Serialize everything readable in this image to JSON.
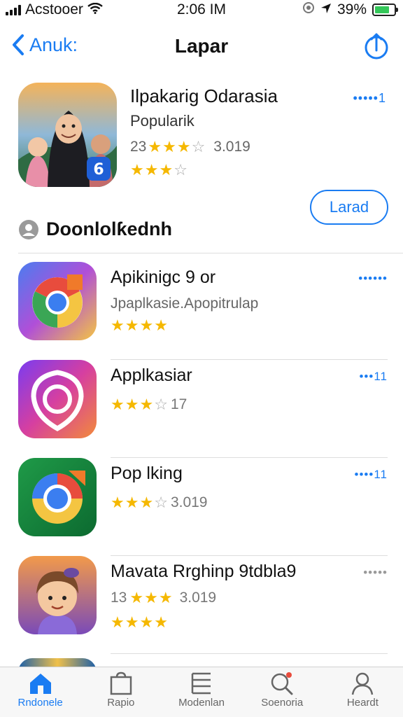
{
  "status": {
    "carrier": "Acstooer",
    "time": "2:06 IM",
    "battery": "39%",
    "battery_level": 0.75
  },
  "nav": {
    "back_label": "Anuk:",
    "title": "Lapar"
  },
  "featured": {
    "title": "Ilpakarig Odarasia",
    "subtitle": "Popularik",
    "rating_prefix": "23",
    "rating_count": "3.019",
    "stars_primary": 3,
    "stars_secondary": 3,
    "more": "•••••1",
    "load_label": "Larad"
  },
  "section": {
    "title": "Doonlolƙednh"
  },
  "apps": [
    {
      "name": "Apikinigc 9 or",
      "subtitle": "Jpaplkasie.Apopitrulap",
      "stars": 4,
      "rating_prefix": "",
      "rating_count": "",
      "more": "••••••"
    },
    {
      "name": "Applkasiar",
      "subtitle": "",
      "stars": 3,
      "rating_prefix": "",
      "rating_count": "17",
      "more": "•••11"
    },
    {
      "name": "Pop lking",
      "subtitle": "",
      "stars": 3,
      "rating_prefix": "",
      "rating_count": "3.019",
      "more": "••••11"
    },
    {
      "name": "Mavata Rrghinp 9tdbla9",
      "subtitle": "",
      "stars": 4,
      "rating_prefix": "13",
      "rating_count": "3.019",
      "more": "•••••"
    }
  ],
  "tabs": [
    {
      "label": "Rndonele",
      "icon": "home-icon",
      "active": true
    },
    {
      "label": "Rapio",
      "icon": "bag-icon",
      "active": false
    },
    {
      "label": "Modenlan",
      "icon": "list-icon",
      "active": false
    },
    {
      "label": "Soenoria",
      "icon": "search-icon",
      "active": false
    },
    {
      "label": "Heardt",
      "icon": "person-icon",
      "active": false
    }
  ],
  "colors": {
    "accent": "#1a7cf2",
    "star": "#f5b800",
    "battery": "#34c759"
  }
}
